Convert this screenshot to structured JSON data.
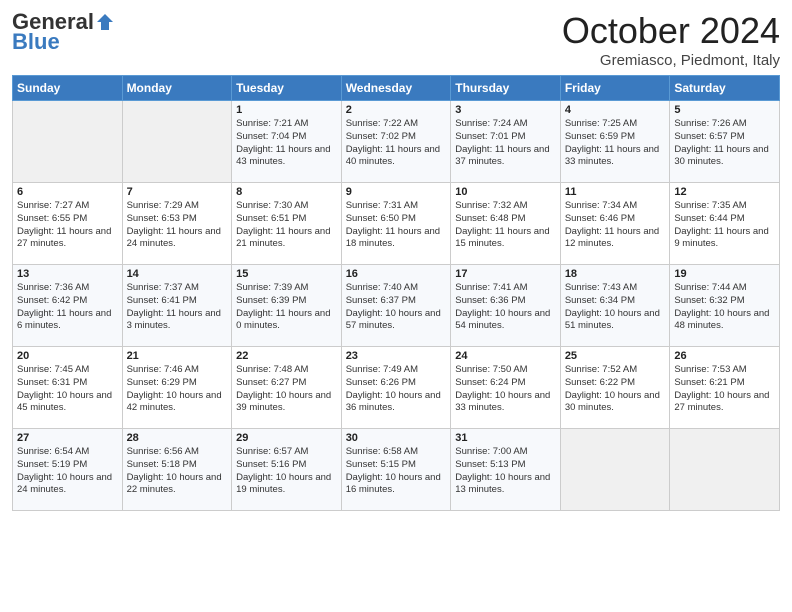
{
  "header": {
    "logo_general": "General",
    "logo_blue": "Blue",
    "month_title": "October 2024",
    "subtitle": "Gremiasco, Piedmont, Italy"
  },
  "days_of_week": [
    "Sunday",
    "Monday",
    "Tuesday",
    "Wednesday",
    "Thursday",
    "Friday",
    "Saturday"
  ],
  "weeks": [
    [
      {
        "day": "",
        "sunrise": "",
        "sunset": "",
        "daylight": ""
      },
      {
        "day": "",
        "sunrise": "",
        "sunset": "",
        "daylight": ""
      },
      {
        "day": "1",
        "sunrise": "Sunrise: 7:21 AM",
        "sunset": "Sunset: 7:04 PM",
        "daylight": "Daylight: 11 hours and 43 minutes."
      },
      {
        "day": "2",
        "sunrise": "Sunrise: 7:22 AM",
        "sunset": "Sunset: 7:02 PM",
        "daylight": "Daylight: 11 hours and 40 minutes."
      },
      {
        "day": "3",
        "sunrise": "Sunrise: 7:24 AM",
        "sunset": "Sunset: 7:01 PM",
        "daylight": "Daylight: 11 hours and 37 minutes."
      },
      {
        "day": "4",
        "sunrise": "Sunrise: 7:25 AM",
        "sunset": "Sunset: 6:59 PM",
        "daylight": "Daylight: 11 hours and 33 minutes."
      },
      {
        "day": "5",
        "sunrise": "Sunrise: 7:26 AM",
        "sunset": "Sunset: 6:57 PM",
        "daylight": "Daylight: 11 hours and 30 minutes."
      }
    ],
    [
      {
        "day": "6",
        "sunrise": "Sunrise: 7:27 AM",
        "sunset": "Sunset: 6:55 PM",
        "daylight": "Daylight: 11 hours and 27 minutes."
      },
      {
        "day": "7",
        "sunrise": "Sunrise: 7:29 AM",
        "sunset": "Sunset: 6:53 PM",
        "daylight": "Daylight: 11 hours and 24 minutes."
      },
      {
        "day": "8",
        "sunrise": "Sunrise: 7:30 AM",
        "sunset": "Sunset: 6:51 PM",
        "daylight": "Daylight: 11 hours and 21 minutes."
      },
      {
        "day": "9",
        "sunrise": "Sunrise: 7:31 AM",
        "sunset": "Sunset: 6:50 PM",
        "daylight": "Daylight: 11 hours and 18 minutes."
      },
      {
        "day": "10",
        "sunrise": "Sunrise: 7:32 AM",
        "sunset": "Sunset: 6:48 PM",
        "daylight": "Daylight: 11 hours and 15 minutes."
      },
      {
        "day": "11",
        "sunrise": "Sunrise: 7:34 AM",
        "sunset": "Sunset: 6:46 PM",
        "daylight": "Daylight: 11 hours and 12 minutes."
      },
      {
        "day": "12",
        "sunrise": "Sunrise: 7:35 AM",
        "sunset": "Sunset: 6:44 PM",
        "daylight": "Daylight: 11 hours and 9 minutes."
      }
    ],
    [
      {
        "day": "13",
        "sunrise": "Sunrise: 7:36 AM",
        "sunset": "Sunset: 6:42 PM",
        "daylight": "Daylight: 11 hours and 6 minutes."
      },
      {
        "day": "14",
        "sunrise": "Sunrise: 7:37 AM",
        "sunset": "Sunset: 6:41 PM",
        "daylight": "Daylight: 11 hours and 3 minutes."
      },
      {
        "day": "15",
        "sunrise": "Sunrise: 7:39 AM",
        "sunset": "Sunset: 6:39 PM",
        "daylight": "Daylight: 11 hours and 0 minutes."
      },
      {
        "day": "16",
        "sunrise": "Sunrise: 7:40 AM",
        "sunset": "Sunset: 6:37 PM",
        "daylight": "Daylight: 10 hours and 57 minutes."
      },
      {
        "day": "17",
        "sunrise": "Sunrise: 7:41 AM",
        "sunset": "Sunset: 6:36 PM",
        "daylight": "Daylight: 10 hours and 54 minutes."
      },
      {
        "day": "18",
        "sunrise": "Sunrise: 7:43 AM",
        "sunset": "Sunset: 6:34 PM",
        "daylight": "Daylight: 10 hours and 51 minutes."
      },
      {
        "day": "19",
        "sunrise": "Sunrise: 7:44 AM",
        "sunset": "Sunset: 6:32 PM",
        "daylight": "Daylight: 10 hours and 48 minutes."
      }
    ],
    [
      {
        "day": "20",
        "sunrise": "Sunrise: 7:45 AM",
        "sunset": "Sunset: 6:31 PM",
        "daylight": "Daylight: 10 hours and 45 minutes."
      },
      {
        "day": "21",
        "sunrise": "Sunrise: 7:46 AM",
        "sunset": "Sunset: 6:29 PM",
        "daylight": "Daylight: 10 hours and 42 minutes."
      },
      {
        "day": "22",
        "sunrise": "Sunrise: 7:48 AM",
        "sunset": "Sunset: 6:27 PM",
        "daylight": "Daylight: 10 hours and 39 minutes."
      },
      {
        "day": "23",
        "sunrise": "Sunrise: 7:49 AM",
        "sunset": "Sunset: 6:26 PM",
        "daylight": "Daylight: 10 hours and 36 minutes."
      },
      {
        "day": "24",
        "sunrise": "Sunrise: 7:50 AM",
        "sunset": "Sunset: 6:24 PM",
        "daylight": "Daylight: 10 hours and 33 minutes."
      },
      {
        "day": "25",
        "sunrise": "Sunrise: 7:52 AM",
        "sunset": "Sunset: 6:22 PM",
        "daylight": "Daylight: 10 hours and 30 minutes."
      },
      {
        "day": "26",
        "sunrise": "Sunrise: 7:53 AM",
        "sunset": "Sunset: 6:21 PM",
        "daylight": "Daylight: 10 hours and 27 minutes."
      }
    ],
    [
      {
        "day": "27",
        "sunrise": "Sunrise: 6:54 AM",
        "sunset": "Sunset: 5:19 PM",
        "daylight": "Daylight: 10 hours and 24 minutes."
      },
      {
        "day": "28",
        "sunrise": "Sunrise: 6:56 AM",
        "sunset": "Sunset: 5:18 PM",
        "daylight": "Daylight: 10 hours and 22 minutes."
      },
      {
        "day": "29",
        "sunrise": "Sunrise: 6:57 AM",
        "sunset": "Sunset: 5:16 PM",
        "daylight": "Daylight: 10 hours and 19 minutes."
      },
      {
        "day": "30",
        "sunrise": "Sunrise: 6:58 AM",
        "sunset": "Sunset: 5:15 PM",
        "daylight": "Daylight: 10 hours and 16 minutes."
      },
      {
        "day": "31",
        "sunrise": "Sunrise: 7:00 AM",
        "sunset": "Sunset: 5:13 PM",
        "daylight": "Daylight: 10 hours and 13 minutes."
      },
      {
        "day": "",
        "sunrise": "",
        "sunset": "",
        "daylight": ""
      },
      {
        "day": "",
        "sunrise": "",
        "sunset": "",
        "daylight": ""
      }
    ]
  ]
}
